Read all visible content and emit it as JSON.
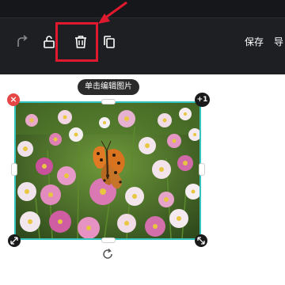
{
  "toolbar": {
    "redo_icon": "redo-icon",
    "unlock_icon": "unlock-icon",
    "delete_icon": "trash-icon",
    "copy_icon": "copy-icon",
    "save_label": "保存",
    "export_label": "导"
  },
  "canvas": {
    "tooltip": "单击编辑图片",
    "layer_count": "+1",
    "delete_badge": "×"
  },
  "colors": {
    "selection_border": "#35c3c0",
    "highlight_red": "#e0192f",
    "toolbar_bg": "#1e1f23"
  }
}
